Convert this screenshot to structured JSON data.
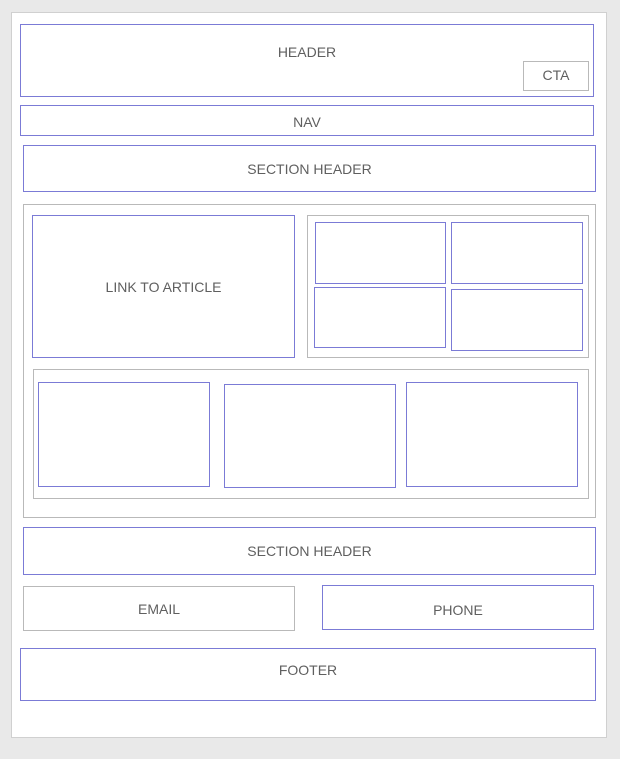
{
  "header": {
    "label": "HEADER",
    "cta_label": "CTA"
  },
  "nav": {
    "label": "NAV"
  },
  "sections": {
    "first_header": "SECTION HEADER",
    "second_header": "SECTION HEADER"
  },
  "feature": {
    "article_link_label": "LINK TO ARTICLE"
  },
  "contact": {
    "email_label": "EMAIL",
    "phone_label": "PHONE"
  },
  "footer": {
    "label": "FOOTER"
  },
  "colors": {
    "box_border": "#7b7bd6",
    "container_border": "#b9b9b9",
    "text": "#5f5f5f",
    "canvas": "#e9e9e9"
  }
}
